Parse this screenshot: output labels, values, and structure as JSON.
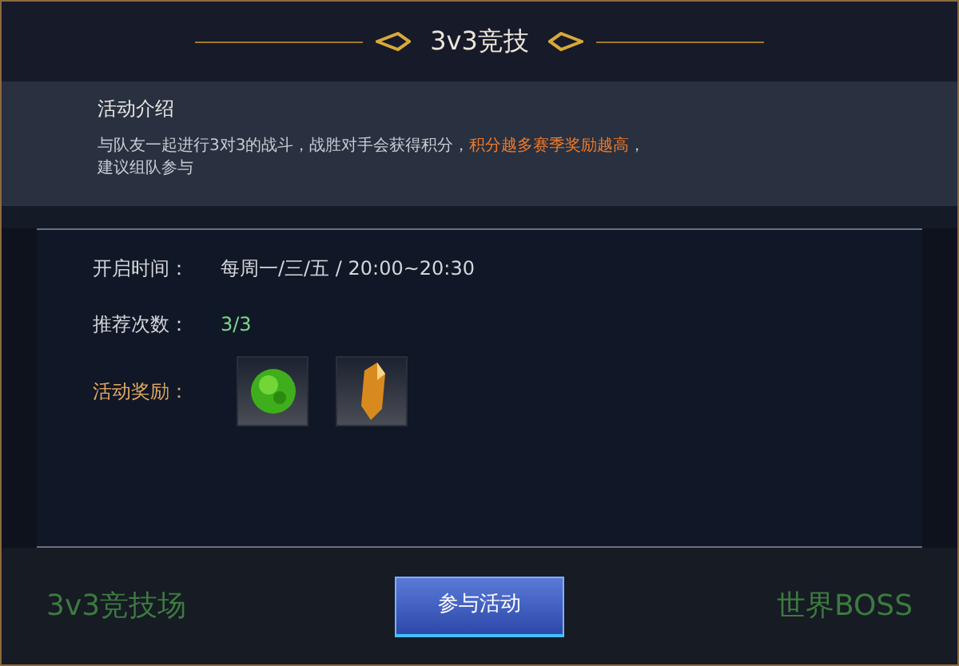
{
  "dialog": {
    "title": "3v3竞技",
    "intro": {
      "heading": "活动介绍",
      "text": "与队友一起进行3对3的战斗，战胜对手会获得积分，",
      "highlight": "积分越多赛季奖励越高",
      "text_end": "，",
      "text_line2": "建议组队参与"
    },
    "info": [
      {
        "kind": "text",
        "label": "开启时间：",
        "value": "每周一/三/五 / 20:00~20:30"
      },
      {
        "kind": "count",
        "label": "推荐次数：",
        "value": "3/3"
      },
      {
        "kind": "rewards",
        "label": "活动奖励：",
        "items": [
          {
            "kind": "orb"
          },
          {
            "kind": "crystal"
          }
        ]
      }
    ],
    "button": "参与活动"
  },
  "background": {
    "left_title": "3v3竞技场",
    "right_title": "世界BOSS"
  }
}
